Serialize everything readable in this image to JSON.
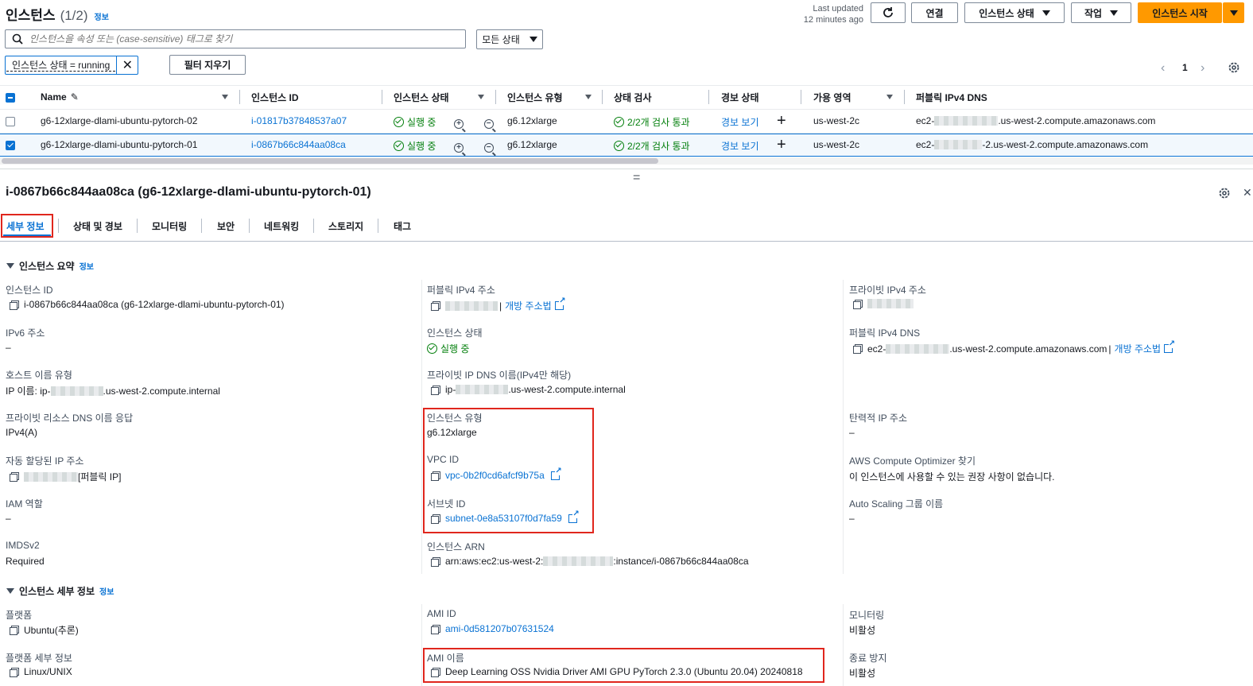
{
  "header": {
    "title": "인스턴스",
    "count": "(1/2)",
    "info": "정보",
    "last_updated_line1": "Last updated",
    "last_updated_line2": "12 minutes ago",
    "connect": "연결",
    "instance_state": "인스턴스 상태",
    "actions": "작업",
    "launch": "인스턴스 시작"
  },
  "search": {
    "placeholder": "인스턴스을 속성 또는 (case-sensitive) 태그로 찾기",
    "state_filter": "모든 상태",
    "chip": "인스턴스 상태 = running",
    "clear": "필터 지우기",
    "page": "1"
  },
  "table": {
    "headers": [
      "Name",
      "인스턴스 ID",
      "인스턴스 상태",
      "인스턴스 유형",
      "상태 검사",
      "경보 상태",
      "가용 영역",
      "퍼블릭 IPv4 DNS"
    ],
    "rows": [
      {
        "name": "g6-12xlarge-dlami-ubuntu-pytorch-02",
        "id": "i-01817b37848537a07",
        "state": "실행 중",
        "type": "g6.12xlarge",
        "check": "2/2개 검사 통과",
        "alarm": "경보 보기",
        "az": "us-west-2c",
        "dns_prefix": "ec2-",
        "dns_suffix": ".us-west-2.compute.amazonaws.com",
        "selected": false
      },
      {
        "name": "g6-12xlarge-dlami-ubuntu-pytorch-01",
        "id": "i-0867b66c844aa08ca",
        "state": "실행 중",
        "type": "g6.12xlarge",
        "check": "2/2개 검사 통과",
        "alarm": "경보 보기",
        "az": "us-west-2c",
        "dns_prefix": "ec2-",
        "dns_suffix": "-2.us-west-2.compute.amazonaws.com",
        "selected": true
      }
    ]
  },
  "detail": {
    "title": "i-0867b66c844aa08ca (g6-12xlarge-dlami-ubuntu-pytorch-01)",
    "tabs": [
      "세부 정보",
      "상태 및 경보",
      "모니터링",
      "보안",
      "네트워킹",
      "스토리지",
      "태그"
    ],
    "summary_title": "인스턴스 요약",
    "details_title": "인스턴스 세부 정보",
    "info": "정보"
  },
  "summary": {
    "instance_id_label": "인스턴스 ID",
    "instance_id": "i-0867b66c844aa08ca (g6-12xlarge-dlami-ubuntu-pytorch-01)",
    "ipv6_label": "IPv6 주소",
    "ipv6": "–",
    "hostname_type_label": "호스트 이름 유형",
    "hostname_prefix": "IP 이름: ip-",
    "hostname_suffix": ".us-west-2.compute.internal",
    "private_dns_resp_label": "프라이빗 리소스 DNS 이름 응답",
    "private_dns_resp": "IPv4(A)",
    "auto_ip_label": "자동 할당된 IP 주소",
    "auto_ip_suffix": "[퍼블릭 IP]",
    "iam_label": "IAM 역할",
    "iam": "–",
    "imds_label": "IMDSv2",
    "imds": "Required",
    "public_ip_label": "퍼블릭 IPv4 주소",
    "open_address": "개방 주소법",
    "state_label": "인스턴스 상태",
    "state": "실행 중",
    "private_dns_label": "프라이빗 IP DNS 이름(IPv4만 해당)",
    "private_dns_prefix": "ip-",
    "private_dns_suffix": ".us-west-2.compute.internal",
    "type_label": "인스턴스 유형",
    "type": "g6.12xlarge",
    "vpc_label": "VPC ID",
    "vpc": "vpc-0b2f0cd6afcf9b75a",
    "subnet_label": "서브넷 ID",
    "subnet": "subnet-0e8a53107f0d7fa59",
    "arn_label": "인스턴스 ARN",
    "arn_prefix": "arn:aws:ec2:us-west-2:",
    "arn_suffix": ":instance/i-0867b66c844aa08ca",
    "private_ip_label": "프라이빗 IPv4 주소",
    "public_dns_label": "퍼블릭 IPv4 DNS",
    "public_dns_prefix": "ec2-",
    "public_dns_suffix": ".us-west-2.compute.amazonaws.com",
    "elastic_label": "탄력적 IP 주소",
    "elastic": "–",
    "optimizer_label": "AWS Compute Optimizer 찾기",
    "optimizer": "이 인스턴스에 사용할 수 있는 권장 사항이 없습니다.",
    "asg_label": "Auto Scaling 그룹 이름",
    "asg": "–"
  },
  "details": {
    "platform_label": "플랫폼",
    "platform": "Ubuntu(추론)",
    "platform_detail_label": "플랫폼 세부 정보",
    "platform_detail": "Linux/UNIX",
    "ami_id_label": "AMI ID",
    "ami_id": "ami-0d581207b07631524",
    "ami_name_label": "AMI 이름",
    "ami_name": "Deep Learning OSS Nvidia Driver AMI GPU PyTorch 2.3.0 (Ubuntu 20.04) 20240818",
    "monitoring_label": "모니터링",
    "monitoring": "비활성",
    "termination_label": "종료 방지",
    "termination": "비활성"
  },
  "colors": {
    "accent": "#0972d3",
    "primary_button": "#ff9900",
    "success": "#037f0c",
    "highlight_box": "#e0261d"
  }
}
